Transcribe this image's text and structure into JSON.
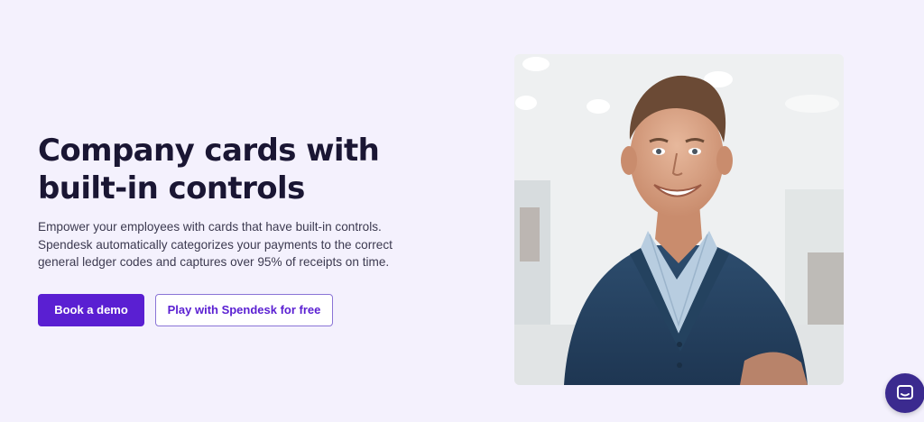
{
  "hero": {
    "headline_lines": [
      "Company cards with",
      "built-in controls"
    ],
    "description_lines": [
      "Empower your employees with cards that have built-in controls.",
      "Spendesk automatically categorizes your payments to the correct",
      "general ledger codes and captures over 95% of receipts on time."
    ],
    "primary_button": "Book a demo",
    "secondary_button": "Play with Spendesk for free"
  },
  "photo": {
    "subject": "smiling man in navy cardigan and striped shirt in an office"
  },
  "chat": {
    "icon": "chat-icon"
  },
  "colors": {
    "background": "#f4f1fd",
    "accent": "#5a1fd2",
    "heading": "#1a1633",
    "chat": "#3b2a8f"
  }
}
